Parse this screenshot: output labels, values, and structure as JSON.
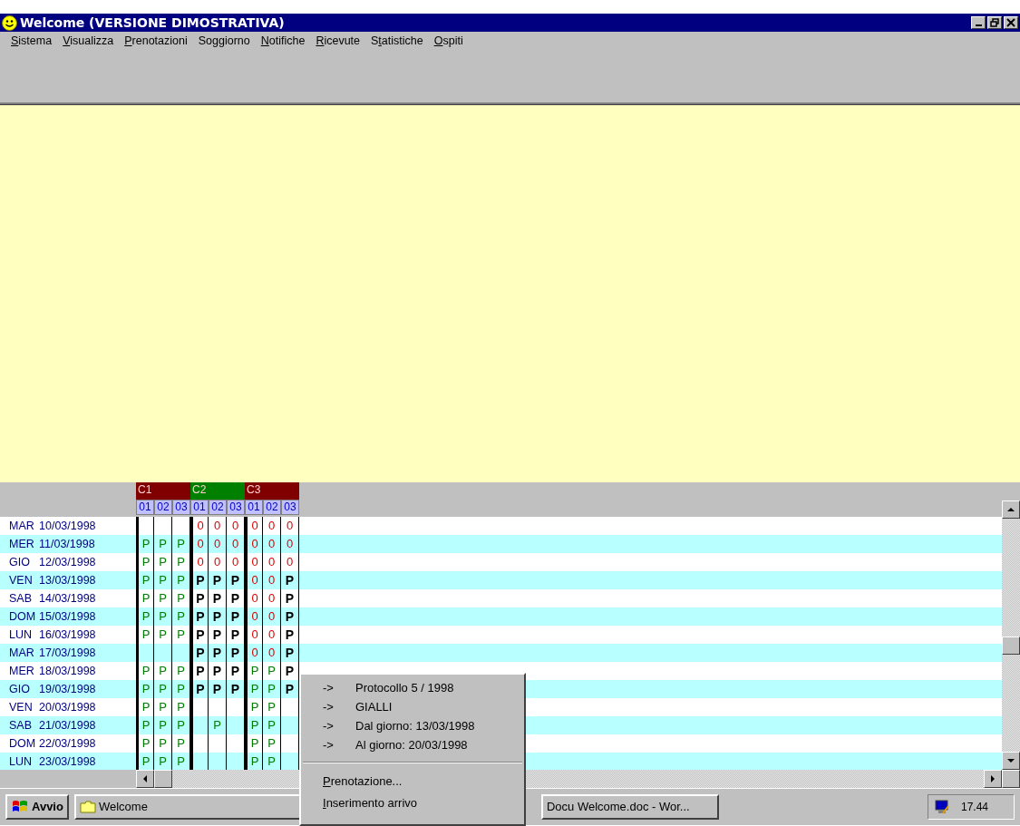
{
  "window": {
    "title": "Welcome (VERSIONE DIMOSTRATIVA)"
  },
  "menu": [
    {
      "key": "S",
      "after": "istema"
    },
    {
      "key": "V",
      "after": "isualizza"
    },
    {
      "key": "P",
      "after": "renotazioni"
    },
    {
      "before": "Soggiorno"
    },
    {
      "key": "N",
      "after": "otifiche"
    },
    {
      "key": "R",
      "after": "icevute"
    },
    {
      "before": "S",
      "key": "t",
      "after": "atistiche"
    },
    {
      "key": "O",
      "after": "spiti"
    }
  ],
  "grid": {
    "groups": [
      {
        "label": "C1",
        "color": "#800000",
        "rooms": [
          "01",
          "02",
          "03"
        ]
      },
      {
        "label": "C2",
        "color": "#008000",
        "rooms": [
          "01",
          "02",
          "03"
        ]
      },
      {
        "label": "C3",
        "color": "#800000",
        "rooms": [
          "01",
          "02",
          "03"
        ]
      }
    ],
    "rows": [
      {
        "day": "MAR",
        "date": "10/03/1998",
        "cells": [
          {
            "kind": "empty"
          },
          {
            "kind": "empty"
          },
          {
            "kind": "empty"
          },
          {
            "kind": "occupied",
            "text": "0"
          },
          {
            "kind": "occupied",
            "text": "0"
          },
          {
            "kind": "occupied",
            "text": "0"
          },
          {
            "kind": "occupied",
            "text": "0"
          },
          {
            "kind": "occupied",
            "text": "0"
          },
          {
            "kind": "occupied",
            "text": "0"
          }
        ]
      },
      {
        "day": "MER",
        "date": "11/03/1998",
        "cells": [
          {
            "kind": "reserved",
            "text": "P"
          },
          {
            "kind": "reserved",
            "text": "P"
          },
          {
            "kind": "reserved",
            "text": "P"
          },
          {
            "kind": "occupied",
            "text": "0"
          },
          {
            "kind": "occupied",
            "text": "0"
          },
          {
            "kind": "occupied",
            "text": "0"
          },
          {
            "kind": "occupied",
            "text": "0"
          },
          {
            "kind": "occupied",
            "text": "0"
          },
          {
            "kind": "occupied",
            "text": "0"
          }
        ]
      },
      {
        "day": "GIO",
        "date": "12/03/1998",
        "cells": [
          {
            "kind": "reserved",
            "text": "P"
          },
          {
            "kind": "reserved",
            "text": "P"
          },
          {
            "kind": "reserved",
            "text": "P"
          },
          {
            "kind": "occupied",
            "text": "0"
          },
          {
            "kind": "occupied",
            "text": "0"
          },
          {
            "kind": "occupied",
            "text": "0"
          },
          {
            "kind": "occupied",
            "text": "0"
          },
          {
            "kind": "occupied",
            "text": "0"
          },
          {
            "kind": "occupied",
            "text": "0"
          }
        ]
      },
      {
        "day": "VEN",
        "date": "13/03/1998",
        "cells": [
          {
            "kind": "reserved",
            "text": "P"
          },
          {
            "kind": "reserved",
            "text": "P"
          },
          {
            "kind": "reserved",
            "text": "P"
          },
          {
            "kind": "confirmed",
            "text": "P"
          },
          {
            "kind": "confirmed",
            "text": "P"
          },
          {
            "kind": "confirmed",
            "text": "P"
          },
          {
            "kind": "occupied",
            "text": "0"
          },
          {
            "kind": "occupied",
            "text": "0"
          },
          {
            "kind": "confirmed",
            "text": "P"
          }
        ]
      },
      {
        "day": "SAB",
        "date": "14/03/1998",
        "cells": [
          {
            "kind": "reserved",
            "text": "P"
          },
          {
            "kind": "reserved",
            "text": "P"
          },
          {
            "kind": "reserved",
            "text": "P"
          },
          {
            "kind": "confirmed",
            "text": "P"
          },
          {
            "kind": "confirmed",
            "text": "P"
          },
          {
            "kind": "confirmed",
            "text": "P"
          },
          {
            "kind": "occupied",
            "text": "0"
          },
          {
            "kind": "occupied",
            "text": "0"
          },
          {
            "kind": "confirmed",
            "text": "P"
          }
        ]
      },
      {
        "day": "DOM",
        "date": "15/03/1998",
        "cells": [
          {
            "kind": "reserved",
            "text": "P"
          },
          {
            "kind": "reserved",
            "text": "P"
          },
          {
            "kind": "reserved",
            "text": "P"
          },
          {
            "kind": "confirmed",
            "text": "P"
          },
          {
            "kind": "confirmed",
            "text": "P"
          },
          {
            "kind": "confirmed",
            "text": "P"
          },
          {
            "kind": "occupied",
            "text": "0"
          },
          {
            "kind": "occupied",
            "text": "0"
          },
          {
            "kind": "confirmed",
            "text": "P"
          }
        ]
      },
      {
        "day": "LUN",
        "date": "16/03/1998",
        "cells": [
          {
            "kind": "reserved",
            "text": "P"
          },
          {
            "kind": "reserved",
            "text": "P"
          },
          {
            "kind": "reserved",
            "text": "P"
          },
          {
            "kind": "confirmed",
            "text": "P"
          },
          {
            "kind": "confirmed",
            "text": "P"
          },
          {
            "kind": "confirmed",
            "text": "P"
          },
          {
            "kind": "occupied",
            "text": "0"
          },
          {
            "kind": "occupied",
            "text": "0"
          },
          {
            "kind": "confirmed",
            "text": "P"
          }
        ]
      },
      {
        "day": "MAR",
        "date": "17/03/1998",
        "cells": [
          {
            "kind": "empty"
          },
          {
            "kind": "empty"
          },
          {
            "kind": "empty"
          },
          {
            "kind": "confirmed",
            "text": "P"
          },
          {
            "kind": "confirmed",
            "text": "P"
          },
          {
            "kind": "confirmed",
            "text": "P"
          },
          {
            "kind": "occupied",
            "text": "0"
          },
          {
            "kind": "occupied",
            "text": "0"
          },
          {
            "kind": "confirmed",
            "text": "P"
          }
        ]
      },
      {
        "day": "MER",
        "date": "18/03/1998",
        "cells": [
          {
            "kind": "reserved",
            "text": "P"
          },
          {
            "kind": "reserved",
            "text": "P"
          },
          {
            "kind": "reserved",
            "text": "P"
          },
          {
            "kind": "confirmed",
            "text": "P"
          },
          {
            "kind": "confirmed",
            "text": "P"
          },
          {
            "kind": "confirmed",
            "text": "P"
          },
          {
            "kind": "reserved",
            "text": "P"
          },
          {
            "kind": "reserved",
            "text": "P"
          },
          {
            "kind": "confirmed",
            "text": "P"
          }
        ]
      },
      {
        "day": "GIO",
        "date": "19/03/1998",
        "cells": [
          {
            "kind": "reserved",
            "text": "P"
          },
          {
            "kind": "reserved",
            "text": "P"
          },
          {
            "kind": "reserved",
            "text": "P"
          },
          {
            "kind": "confirmed",
            "text": "P"
          },
          {
            "kind": "confirmed",
            "text": "P"
          },
          {
            "kind": "confirmed",
            "text": "P"
          },
          {
            "kind": "reserved",
            "text": "P"
          },
          {
            "kind": "reserved",
            "text": "P"
          },
          {
            "kind": "confirmed",
            "text": "P"
          }
        ]
      },
      {
        "day": "VEN",
        "date": "20/03/1998",
        "cells": [
          {
            "kind": "reserved",
            "text": "P"
          },
          {
            "kind": "reserved",
            "text": "P"
          },
          {
            "kind": "reserved",
            "text": "P"
          },
          {
            "kind": "empty"
          },
          {
            "kind": "empty"
          },
          {
            "kind": "empty"
          },
          {
            "kind": "reserved",
            "text": "P"
          },
          {
            "kind": "reserved",
            "text": "P"
          },
          {
            "kind": "empty"
          }
        ]
      },
      {
        "day": "SAB",
        "date": "21/03/1998",
        "cells": [
          {
            "kind": "reserved",
            "text": "P"
          },
          {
            "kind": "reserved",
            "text": "P"
          },
          {
            "kind": "reserved",
            "text": "P"
          },
          {
            "kind": "empty"
          },
          {
            "kind": "reserved",
            "text": "P"
          },
          {
            "kind": "empty"
          },
          {
            "kind": "reserved",
            "text": "P"
          },
          {
            "kind": "reserved",
            "text": "P"
          },
          {
            "kind": "empty"
          }
        ]
      },
      {
        "day": "DOM",
        "date": "22/03/1998",
        "cells": [
          {
            "kind": "reserved",
            "text": "P"
          },
          {
            "kind": "reserved",
            "text": "P"
          },
          {
            "kind": "reserved",
            "text": "P"
          },
          {
            "kind": "empty"
          },
          {
            "kind": "empty"
          },
          {
            "kind": "empty"
          },
          {
            "kind": "reserved",
            "text": "P"
          },
          {
            "kind": "reserved",
            "text": "P"
          },
          {
            "kind": "empty"
          }
        ]
      },
      {
        "day": "LUN",
        "date": "23/03/1998",
        "cells": [
          {
            "kind": "reserved",
            "text": "P"
          },
          {
            "kind": "reserved",
            "text": "P"
          },
          {
            "kind": "reserved",
            "text": "P"
          },
          {
            "kind": "empty"
          },
          {
            "kind": "empty"
          },
          {
            "kind": "empty"
          },
          {
            "kind": "reserved",
            "text": "P"
          },
          {
            "kind": "reserved",
            "text": "P"
          },
          {
            "kind": "empty"
          }
        ]
      }
    ]
  },
  "context_menu": {
    "info": [
      {
        "arrow": "->",
        "text": "Protocollo 5 / 1998"
      },
      {
        "arrow": "->",
        "text": "GIALLI"
      },
      {
        "arrow": "->",
        "text": "Dal giorno: 13/03/1998"
      },
      {
        "arrow": "->",
        "text": "Al giorno: 20/03/1998"
      }
    ],
    "actions": [
      {
        "key": "P",
        "after": "renotazione..."
      },
      {
        "key": "I",
        "after": "nserimento arrivo"
      }
    ]
  },
  "taskbar": {
    "start": "Avvio",
    "tasks": [
      {
        "kind": "folder",
        "label": "Welcome"
      },
      {
        "kind": "plain",
        "label": "Docu Welcome.doc - Wor..."
      }
    ],
    "clock": "17.44"
  }
}
